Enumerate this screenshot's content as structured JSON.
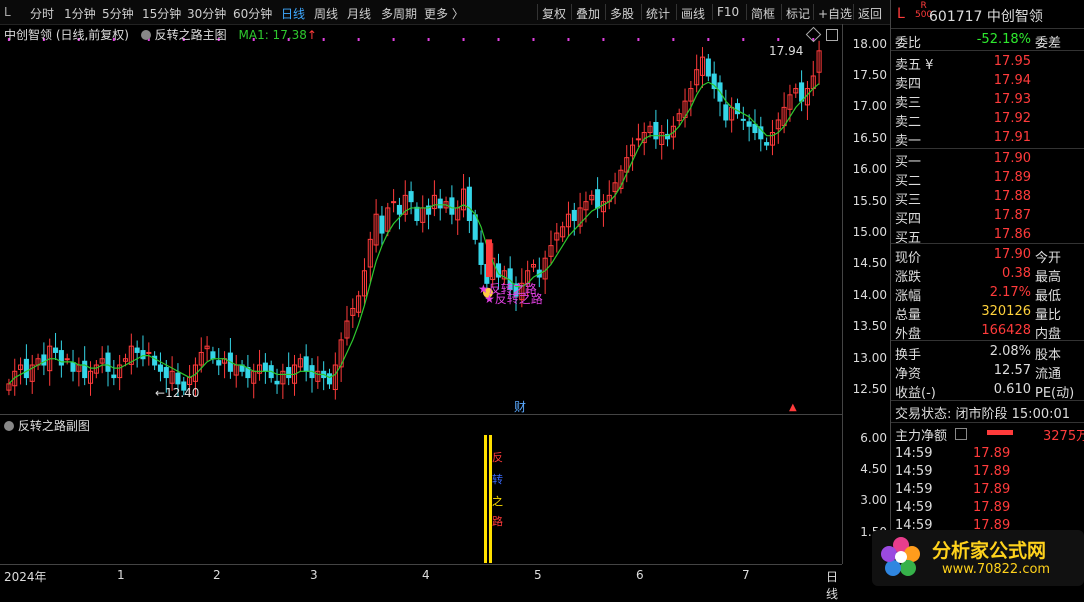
{
  "toolbar": {
    "left": [
      "L",
      "分时",
      "1分钟",
      "5分钟",
      "15分钟",
      "30分钟",
      "60分钟",
      "日线",
      "周线",
      "月线",
      "多周期",
      "更多 〉"
    ],
    "right": [
      "复权",
      "叠加",
      "多股",
      "统计",
      "画线",
      "F10",
      "简框",
      "标记",
      "+自选",
      "返回"
    ],
    "active": "日线"
  },
  "main": {
    "title": "中创智领 (日线,前复权)",
    "indicator": "反转之路主图",
    "ma": "MA1: 17.38",
    "ma_arrow": "↑",
    "high_label": "17.94",
    "low_label": "12.40",
    "signal_1": "反转之路",
    "signal_2": "反转之路",
    "cai": "财"
  },
  "sub": {
    "title": "反转之路副图",
    "words": [
      "反",
      "转",
      "之",
      "路"
    ]
  },
  "colors": {
    "up": "#ff3b3b",
    "down": "#35d6e8",
    "ma": "#2ec82e",
    "magenta": "#e040e0",
    "yellow": "#ffe000"
  },
  "chart_data": {
    "type": "candlestick",
    "title": "中创智领 (日线,前复权)",
    "ylim": [
      12.2,
      18.2
    ],
    "yticks": [
      "18.00",
      "17.50",
      "17.00",
      "16.50",
      "16.00",
      "15.50",
      "15.00",
      "14.50",
      "14.00",
      "13.50",
      "13.00",
      "12.50"
    ],
    "xticks": [
      "2024年",
      "1",
      "2",
      "3",
      "4",
      "5",
      "6",
      "7",
      "日线"
    ],
    "close": [
      12.6,
      12.8,
      12.9,
      12.7,
      12.9,
      13.0,
      12.9,
      13.2,
      13.1,
      12.9,
      13.0,
      12.8,
      12.9,
      12.7,
      12.8,
      12.9,
      13.0,
      12.8,
      12.7,
      12.9,
      13.0,
      13.2,
      13.1,
      13.0,
      13.1,
      12.9,
      12.8,
      12.7,
      12.8,
      12.6,
      12.5,
      12.7,
      12.9,
      13.1,
      13.2,
      13.0,
      12.9,
      13.0,
      12.8,
      12.9,
      12.8,
      12.7,
      12.8,
      12.9,
      12.8,
      12.7,
      12.6,
      12.8,
      12.7,
      12.9,
      13.0,
      12.8,
      12.7,
      12.8,
      12.7,
      12.6,
      12.9,
      13.3,
      13.6,
      13.8,
      14.0,
      14.4,
      14.9,
      15.3,
      15.0,
      15.4,
      15.5,
      15.3,
      15.6,
      15.5,
      15.2,
      15.4,
      15.3,
      15.6,
      15.4,
      15.5,
      15.3,
      15.4,
      15.7,
      15.2,
      14.9,
      14.5,
      14.2,
      14.6,
      14.3,
      14.4,
      14.1,
      14.0,
      14.2,
      14.4,
      14.5,
      14.3,
      14.6,
      14.8,
      15.0,
      15.1,
      15.3,
      15.2,
      15.4,
      15.5,
      15.6,
      15.4,
      15.5,
      15.6,
      15.8,
      16.0,
      16.2,
      16.4,
      16.5,
      16.6,
      16.7,
      16.5,
      16.6,
      16.5,
      16.7,
      16.9,
      17.1,
      17.3,
      17.6,
      17.8,
      17.5,
      17.3,
      17.1,
      16.8,
      17.0,
      16.9,
      16.8,
      16.7,
      16.6,
      16.5,
      16.4,
      16.6,
      16.8,
      17.0,
      17.2,
      17.3,
      17.1,
      17.3,
      17.5,
      17.9
    ],
    "ma_close": [
      12.6,
      12.7,
      12.75,
      12.8,
      12.85,
      12.9,
      12.95,
      13.0,
      13.0,
      12.95,
      12.95,
      12.95,
      12.9,
      12.9,
      12.85,
      12.85,
      12.9,
      12.9,
      12.85,
      12.85,
      12.9,
      12.95,
      13.0,
      13.05,
      13.05,
      13.0,
      12.95,
      12.9,
      12.85,
      12.8,
      12.75,
      12.7,
      12.75,
      12.85,
      12.95,
      13.0,
      13.0,
      13.0,
      12.95,
      12.9,
      12.9,
      12.85,
      12.8,
      12.8,
      12.8,
      12.8,
      12.75,
      12.75,
      12.75,
      12.75,
      12.8,
      12.8,
      12.8,
      12.75,
      12.75,
      12.7,
      12.75,
      12.9,
      13.1,
      13.3,
      13.55,
      13.85,
      14.2,
      14.55,
      14.8,
      15.0,
      15.15,
      15.25,
      15.35,
      15.4,
      15.4,
      15.4,
      15.4,
      15.45,
      15.45,
      15.45,
      15.4,
      15.4,
      15.45,
      15.4,
      15.3,
      15.1,
      14.8,
      14.55,
      14.35,
      14.3,
      14.25,
      14.15,
      14.15,
      14.2,
      14.3,
      14.35,
      14.4,
      14.5,
      14.65,
      14.8,
      14.95,
      15.05,
      15.15,
      15.25,
      15.35,
      15.4,
      15.45,
      15.5,
      15.6,
      15.75,
      15.95,
      16.15,
      16.35,
      16.5,
      16.55,
      16.55,
      16.55,
      16.55,
      16.6,
      16.7,
      16.85,
      17.0,
      17.2,
      17.35,
      17.4,
      17.35,
      17.25,
      17.1,
      17.0,
      16.95,
      16.9,
      16.85,
      16.75,
      16.65,
      16.55,
      16.55,
      16.6,
      16.7,
      16.85,
      17.0,
      17.1,
      17.2,
      17.3,
      17.38
    ],
    "sub_ylim": [
      0,
      7
    ],
    "sub_yticks": [
      "6.00",
      "4.50",
      "3.00",
      "1.50"
    ]
  },
  "panel": {
    "ticker_prefix": "L",
    "ticker_badge_top": "R",
    "ticker_badge_bot": "500",
    "code_name": "601717 中创智领",
    "weibi_label": "委比",
    "weibi_value": "-52.18%",
    "weicha_label": "委差",
    "asks": [
      {
        "label": "卖五",
        "mark": "¥",
        "price": "17.95"
      },
      {
        "label": "卖四",
        "mark": "",
        "price": "17.94"
      },
      {
        "label": "卖三",
        "mark": "",
        "price": "17.93"
      },
      {
        "label": "卖二",
        "mark": "",
        "price": "17.92"
      },
      {
        "label": "卖一",
        "mark": "",
        "price": "17.91"
      }
    ],
    "bids": [
      {
        "label": "买一",
        "price": "17.90"
      },
      {
        "label": "买二",
        "price": "17.89"
      },
      {
        "label": "买三",
        "price": "17.88"
      },
      {
        "label": "买四",
        "price": "17.87"
      },
      {
        "label": "买五",
        "price": "17.86"
      }
    ],
    "stats1": [
      {
        "label": "现价",
        "value": "17.90",
        "color": "red",
        "label2": "今开"
      },
      {
        "label": "涨跌",
        "value": "0.38",
        "color": "red",
        "label2": "最高"
      },
      {
        "label": "涨幅",
        "value": "2.17%",
        "color": "red",
        "label2": "最低"
      },
      {
        "label": "总量",
        "value": "320126",
        "color": "yel",
        "label2": "量比"
      },
      {
        "label": "外盘",
        "value": "166428",
        "color": "red",
        "label2": "内盘"
      }
    ],
    "stats2": [
      {
        "label": "换手",
        "value": "2.08%",
        "label2": "股本"
      },
      {
        "label": "净资",
        "value": "12.57",
        "label2": "流通"
      },
      {
        "label": "收益(-)",
        "value": "0.610",
        "label2": "PE(动)"
      }
    ],
    "trade_status": "交易状态: 闭市阶段 15:00:01",
    "net_label": "主力净额",
    "net_value": "3275万",
    "ticks": [
      {
        "time": "14:59",
        "price": "17.89"
      },
      {
        "time": "14:59",
        "price": "17.89"
      },
      {
        "time": "14:59",
        "price": "17.89"
      },
      {
        "time": "14:59",
        "price": "17.89"
      },
      {
        "time": "14:59",
        "price": "17.89"
      }
    ]
  },
  "logo": {
    "text": "分析家公式网",
    "url": "www.70822.com"
  }
}
